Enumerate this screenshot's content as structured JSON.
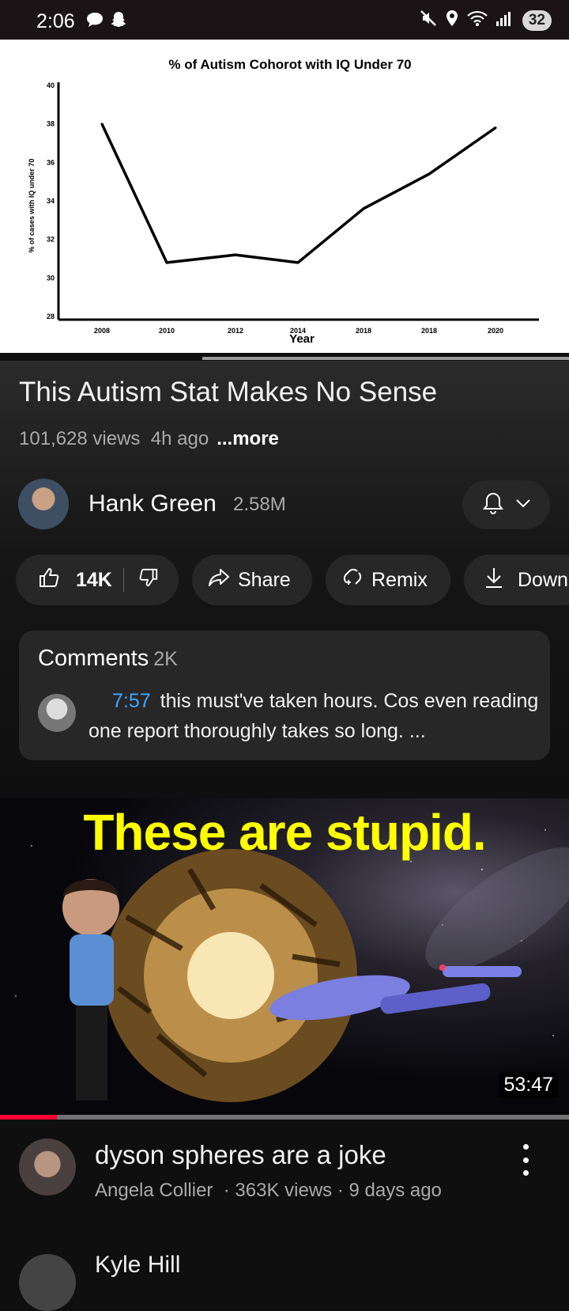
{
  "status_bar": {
    "time": "2:06",
    "battery": "32"
  },
  "chart_data": {
    "type": "line",
    "title": "% of Autism Cohorot with IQ Under 70",
    "xlabel": "Year",
    "ylabel": "% of cases with IQ under 70",
    "x_tick_labels": [
      "2008",
      "2010",
      "2012",
      "2014",
      "2018",
      "2018",
      "2020"
    ],
    "y_ticks": [
      28,
      30,
      32,
      34,
      36,
      38,
      40
    ],
    "ylim": [
      28,
      40
    ],
    "series": [
      {
        "values": [
          38.0,
          30.8,
          31.2,
          30.8,
          33.6,
          35.4,
          37.8
        ]
      }
    ],
    "grid": false
  },
  "video": {
    "title": "This Autism Stat Makes No Sense",
    "views": "101,628 views",
    "age": "4h ago",
    "more": "...more"
  },
  "channel": {
    "name": "Hank Green",
    "subscribers": "2.58M"
  },
  "actions": {
    "likes": "14K",
    "share": "Share",
    "remix": "Remix",
    "download": "Down"
  },
  "comments": {
    "label": "Comments",
    "count": "2K",
    "top_comment": {
      "timestamp": "7:57",
      "text": "this must've taken hours. Cos even reading one report thoroughly takes so long. ..."
    }
  },
  "next_video": {
    "thumbnail_headline": "These are stupid.",
    "duration": "53:47",
    "watched_fraction": 0.1,
    "title": "dyson spheres are a joke",
    "channel": "Angela Collier",
    "meta": "· 363K views · 9 days ago"
  },
  "peek_video": {
    "title": "Kyle Hill"
  },
  "colors": {
    "accent_red": "#ff0033",
    "link_blue": "#3ea6ff",
    "background": "#0f0f0f"
  }
}
